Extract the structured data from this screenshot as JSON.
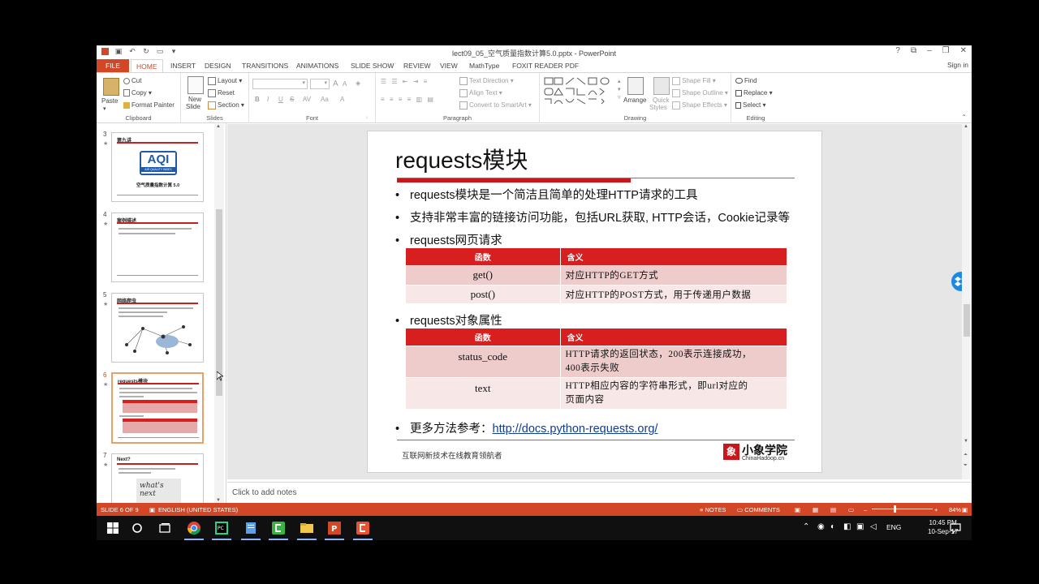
{
  "window": {
    "title": "lect09_05_空气质量指数计算5.0.pptx - PowerPoint",
    "controls": [
      "?",
      "⧉",
      "–",
      "❐",
      "✕"
    ]
  },
  "tabs": {
    "file": "FILE",
    "items": [
      "HOME",
      "INSERT",
      "DESIGN",
      "TRANSITIONS",
      "ANIMATIONS",
      "SLIDE SHOW",
      "REVIEW",
      "VIEW",
      "MathType",
      "FOXIT READER PDF"
    ],
    "signin": "Sign in"
  },
  "ribbon": {
    "clipboard": {
      "paste": "Paste",
      "cut": "Cut",
      "copy": "Copy",
      "format_painter": "Format Painter",
      "label": "Clipboard"
    },
    "slides": {
      "new_slide": "New",
      "new_slide2": "Slide",
      "layout": "Layout",
      "reset": "Reset",
      "section": "Section",
      "label": "Slides"
    },
    "font": {
      "label": "Font",
      "bold": "B",
      "italic": "I",
      "underline": "U",
      "strike": "S",
      "spacing": "AV",
      "case": "Aa",
      "grow": "A",
      "shrink": "A"
    },
    "paragraph": {
      "text_direction": "Text Direction",
      "align_text": "Align Text",
      "smartart": "Convert to SmartArt",
      "label": "Paragraph"
    },
    "drawing": {
      "arrange": "Arrange",
      "quick_styles": "Quick",
      "quick_styles2": "Styles",
      "shape_fill": "Shape Fill",
      "shape_outline": "Shape Outline",
      "shape_effects": "Shape Effects",
      "label": "Drawing"
    },
    "editing": {
      "find": "Find",
      "replace": "Replace",
      "select": "Select",
      "label": "Editing"
    }
  },
  "thumbnails": [
    {
      "num": "3",
      "title": "第九讲",
      "subtitle": "空气质量指数计算 5.0",
      "logo": "AQI",
      "logo_sub": "AIR QUALITY INDEX"
    },
    {
      "num": "4",
      "title": "案例描述"
    },
    {
      "num": "5",
      "title": "网络爬虫"
    },
    {
      "num": "6",
      "title": "requests模块"
    },
    {
      "num": "7",
      "title": "Next?",
      "image_text": "what's next"
    }
  ],
  "slide": {
    "title": "requests模块",
    "bullets": [
      "requests模块是一个简洁且简单的处理HTTP请求的工具",
      "支持非常丰富的链接访问功能，包括URL获取, HTTP会话，Cookie记录等",
      "requests网页请求",
      "requests对象属性"
    ],
    "table1": {
      "headers": [
        "函数",
        "含义"
      ],
      "rows": [
        [
          "get()",
          "对应HTTP的GET方式"
        ],
        [
          "post()",
          "对应HTTP的POST方式，用于传递用户数据"
        ]
      ]
    },
    "table2": {
      "headers": [
        "函数",
        "含义"
      ],
      "rows": [
        [
          "status_code",
          "HTTP请求的返回状态，200表示连接成功，",
          "400表示失败"
        ],
        [
          "text",
          "HTTP相应内容的字符串形式，即url对应的",
          "页面内容"
        ]
      ]
    },
    "more_label": "更多方法参考：",
    "more_link": "http://docs.python-requests.org/",
    "footer": "互联网新技术在线教育领航者",
    "logo_name": "小象学院",
    "logo_sub": "ChinaHadoop.cn"
  },
  "notes": {
    "placeholder": "Click to add notes"
  },
  "status": {
    "slide": "SLIDE 6 OF 9",
    "language": "ENGLISH (UNITED STATES)",
    "notes": "NOTES",
    "comments": "COMMENTS",
    "zoom": "84%"
  },
  "taskbar": {
    "ime": "ENG",
    "time": "10:45 PM",
    "date": "10-Sep-17"
  },
  "colors": {
    "accent": "#d24726",
    "slide_red": "#d71f1f",
    "link": "#0f3d96"
  }
}
